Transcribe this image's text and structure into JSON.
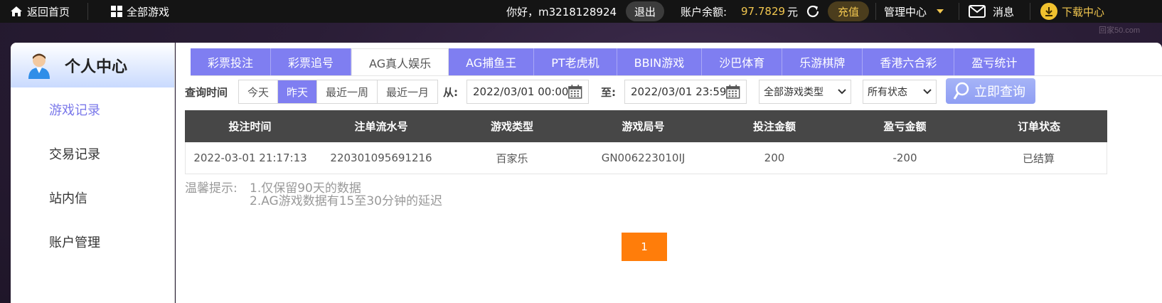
{
  "topbar": {
    "home": "返回首页",
    "all_games": "全部游戏",
    "greeting": "你好，m3218128924",
    "logout": "退出",
    "balance_label": "账户余额:",
    "balance_value": "97.7829",
    "balance_unit": "元",
    "recharge": "充值",
    "manage": "管理中心",
    "messages": "消息",
    "download": "下载中心"
  },
  "watermark": "回家50.com",
  "sidebar": {
    "title": "个人中心",
    "items": [
      {
        "label": "游戏记录",
        "active": true
      },
      {
        "label": "交易记录",
        "active": false
      },
      {
        "label": "站内信",
        "active": false
      },
      {
        "label": "账户管理",
        "active": false
      }
    ]
  },
  "tabs": [
    {
      "label": "彩票投注",
      "active": false
    },
    {
      "label": "彩票追号",
      "active": false
    },
    {
      "label": "AG真人娱乐",
      "active": true
    },
    {
      "label": "AG捕鱼王",
      "active": false
    },
    {
      "label": "PT老虎机",
      "active": false
    },
    {
      "label": "BBIN游戏",
      "active": false
    },
    {
      "label": "沙巴体育",
      "active": false
    },
    {
      "label": "乐游棋牌",
      "active": false
    },
    {
      "label": "香港六合彩",
      "active": false
    },
    {
      "label": "盈亏统计",
      "active": false
    }
  ],
  "filter": {
    "query_time_label": "查询时间",
    "quick": [
      {
        "label": "今天",
        "active": false
      },
      {
        "label": "昨天",
        "active": true
      },
      {
        "label": "最近一周",
        "active": false
      },
      {
        "label": "最近一月",
        "active": false
      }
    ],
    "from_label": "从:",
    "from_value": "2022/03/01 00:00",
    "to_label": "至:",
    "to_value": "2022/03/01 23:59",
    "game_type": "全部游戏类型",
    "status": "所有状态",
    "query_button": "立即查询"
  },
  "table": {
    "headers": [
      "投注时间",
      "注单流水号",
      "游戏类型",
      "游戏局号",
      "投注金额",
      "盈亏金额",
      "订单状态"
    ],
    "rows": [
      [
        "2022-03-01 21:17:13",
        "220301095691216",
        "百家乐",
        "GN006223010IJ",
        "200",
        "-200",
        "已结算"
      ]
    ]
  },
  "tips": {
    "label": "温馨提示:",
    "lines": [
      "1.仅保留90天的数据",
      "2.AG游戏数据有15至30分钟的延迟"
    ]
  },
  "pagination": {
    "current": "1"
  },
  "colors": {
    "accent": "#7f7ef1",
    "gold": "#f1c64f",
    "pager": "#ff7d0a",
    "table_header": "#474747"
  }
}
